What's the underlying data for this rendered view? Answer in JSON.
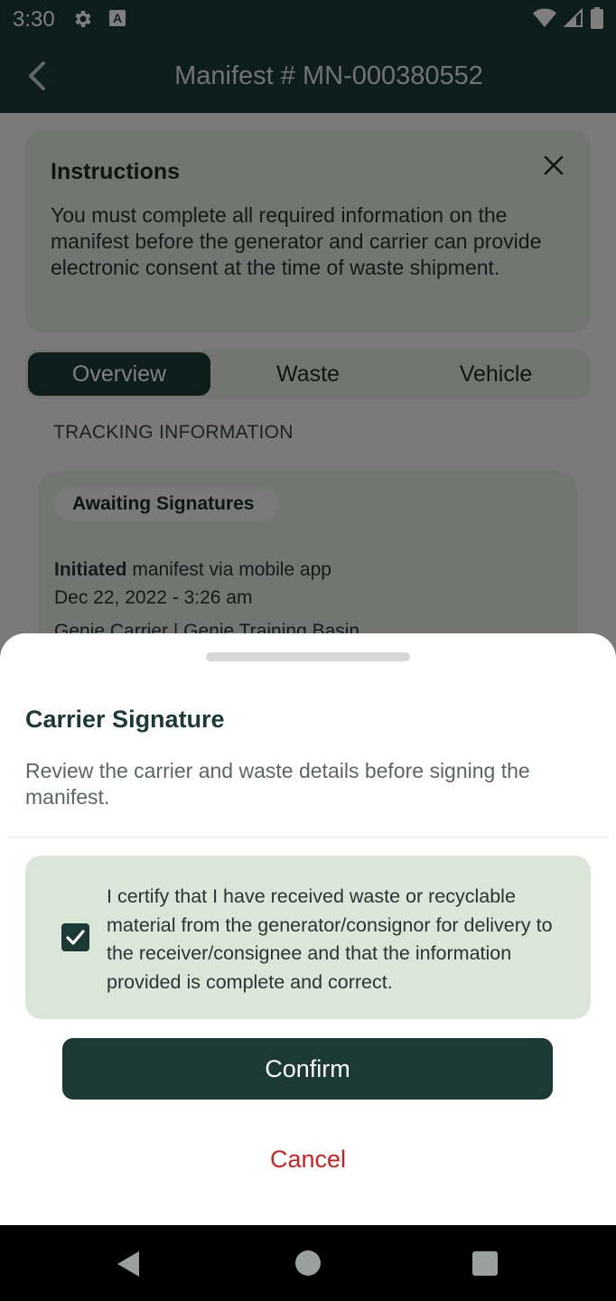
{
  "status_bar": {
    "time": "3:30",
    "a_badge": "A"
  },
  "app_bar": {
    "title": "Manifest # MN-000380552"
  },
  "instructions": {
    "title": "Instructions",
    "body": "You must complete all required information on the manifest before the generator and carrier can provide electronic consent at the time of waste shipment."
  },
  "tabs": [
    {
      "label": "Overview",
      "active": true
    },
    {
      "label": "Waste",
      "active": false
    },
    {
      "label": "Vehicle",
      "active": false
    }
  ],
  "tracking": {
    "section_label": "TRACKING INFORMATION",
    "status": "Awaiting Signatures",
    "event_action": "Initiated",
    "event_detail": "manifest via mobile app",
    "event_date": "Dec 22, 2022 - 3:26 am",
    "next_event_partial": "Genie Carrier | Genie Training Basin"
  },
  "sheet": {
    "title": "Carrier Signature",
    "description": "Review the carrier and waste details before signing the manifest.",
    "certify_text": "I certify that I have received waste or recyclable material from the generator/consignor for delivery to the receiver/consignee and that the information provided is complete and correct.",
    "certify_checked": true,
    "confirm_label": "Confirm",
    "cancel_label": "Cancel"
  },
  "colors": {
    "primary": "#1b3a35",
    "certify_bg": "#dae6d7",
    "cancel": "#d11f1f"
  }
}
